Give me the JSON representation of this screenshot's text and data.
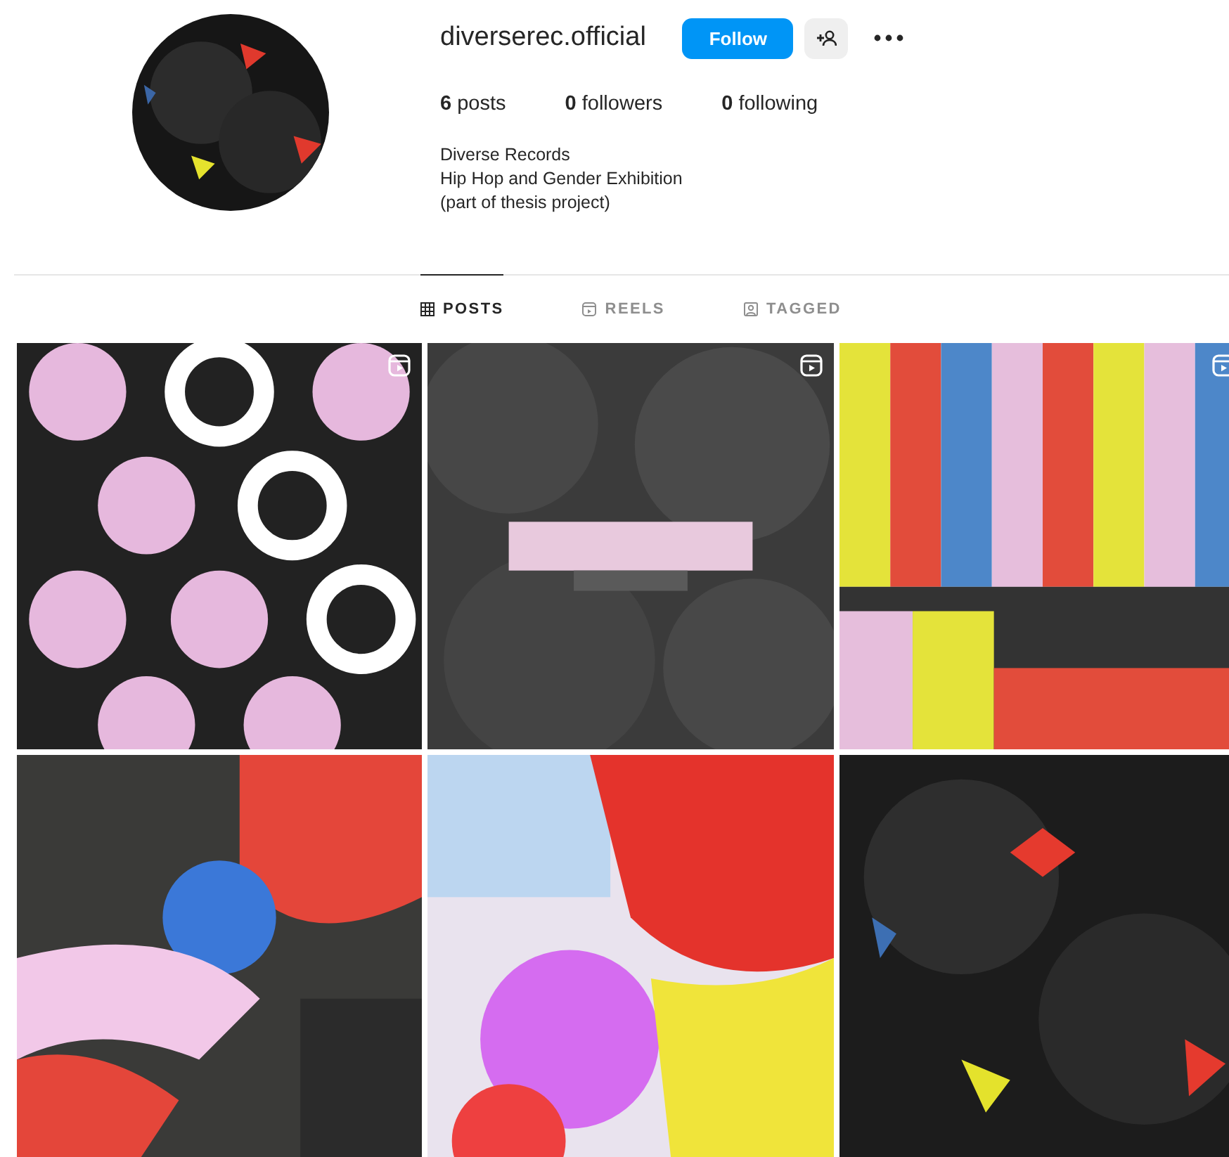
{
  "profile": {
    "username": "diverserec.official",
    "follow_button": "Follow",
    "stats": [
      {
        "count": "6",
        "label": "posts"
      },
      {
        "count": "0",
        "label": "followers"
      },
      {
        "count": "0",
        "label": "following"
      }
    ],
    "bio": [
      "Diverse Records",
      "Hip Hop and Gender Exhibition",
      "(part of thesis project)"
    ]
  },
  "tabs": [
    {
      "label": "POSTS",
      "kind": "grid",
      "selected": true
    },
    {
      "label": "REELS",
      "kind": "reels",
      "selected": false
    },
    {
      "label": "TAGGED",
      "kind": "tagged",
      "selected": false
    }
  ],
  "posts": [
    {
      "kind": "picture",
      "reel": true
    },
    {
      "kind": "picture",
      "reel": true
    },
    {
      "kind": "picture",
      "reel": true
    },
    {
      "kind": "picture",
      "reel": false
    },
    {
      "kind": "picture",
      "reel": false
    },
    {
      "kind": "picture",
      "reel": false
    }
  ]
}
